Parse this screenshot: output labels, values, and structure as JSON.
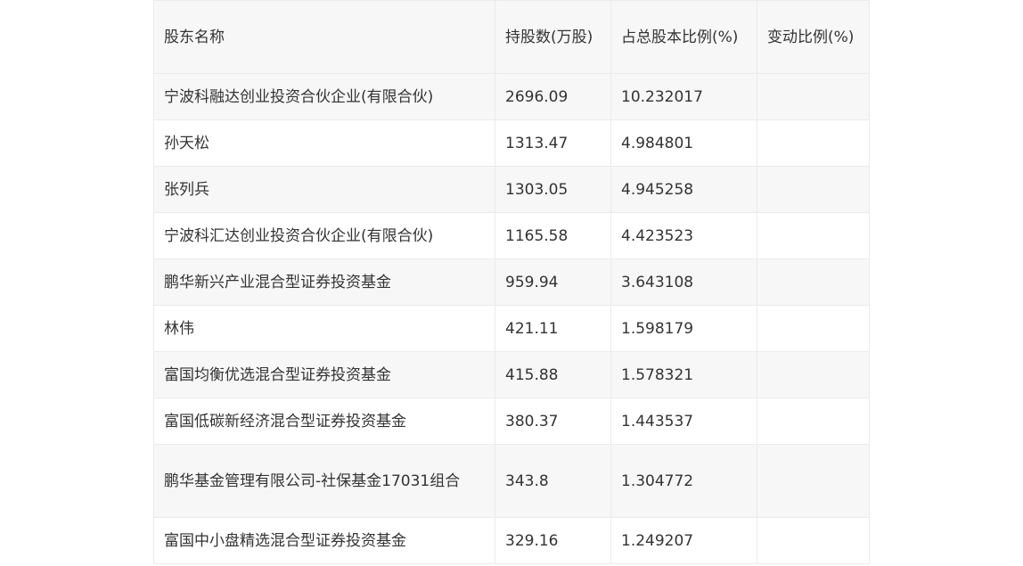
{
  "table": {
    "headers": [
      "股东名称",
      "持股数(万股)",
      "占总股本比例(%)",
      "变动比例(%)"
    ],
    "rows": [
      {
        "name": "宁波科融达创业投资合伙企业(有限合伙)",
        "shares": "2696.09",
        "ratio": "10.232017",
        "change": ""
      },
      {
        "name": "孙天松",
        "shares": "1313.47",
        "ratio": "4.984801",
        "change": ""
      },
      {
        "name": "张列兵",
        "shares": "1303.05",
        "ratio": "4.945258",
        "change": ""
      },
      {
        "name": "宁波科汇达创业投资合伙企业(有限合伙)",
        "shares": "1165.58",
        "ratio": "4.423523",
        "change": ""
      },
      {
        "name": "鹏华新兴产业混合型证券投资基金",
        "shares": "959.94",
        "ratio": "3.643108",
        "change": ""
      },
      {
        "name": "林伟",
        "shares": "421.11",
        "ratio": "1.598179",
        "change": ""
      },
      {
        "name": "富国均衡优选混合型证券投资基金",
        "shares": "415.88",
        "ratio": "1.578321",
        "change": ""
      },
      {
        "name": "富国低碳新经济混合型证券投资基金",
        "shares": "380.37",
        "ratio": "1.443537",
        "change": ""
      },
      {
        "name": "鹏华基金管理有限公司-社保基金17031组合",
        "shares": "343.8",
        "ratio": "1.304772",
        "change": ""
      },
      {
        "name": "富国中小盘精选混合型证券投资基金",
        "shares": "329.16",
        "ratio": "1.249207",
        "change": ""
      }
    ]
  }
}
